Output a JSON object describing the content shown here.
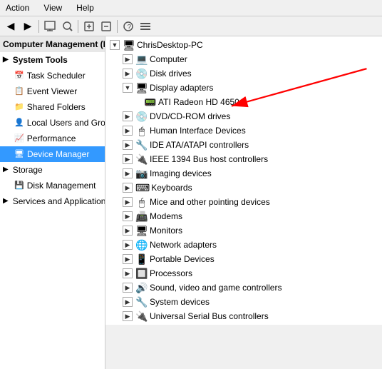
{
  "menu": {
    "items": [
      "Action",
      "View",
      "Help"
    ]
  },
  "toolbar": {
    "buttons": [
      "←",
      "→",
      "⬛",
      "🔧",
      "🔍",
      "⬜",
      "🗑",
      "▶"
    ]
  },
  "left_panel": {
    "header": "Computer Management (Local",
    "sections": [
      {
        "label": "System Tools",
        "bold": true
      },
      {
        "label": "Task Scheduler",
        "indent": 1
      },
      {
        "label": "Event Viewer",
        "indent": 1
      },
      {
        "label": "Shared Folders",
        "indent": 1
      },
      {
        "label": "Local Users and Groups",
        "indent": 1
      },
      {
        "label": "Performance",
        "indent": 1
      },
      {
        "label": "Device Manager",
        "indent": 1,
        "selected": true
      },
      {
        "label": "Storage",
        "bold": false
      },
      {
        "label": "Disk Management",
        "indent": 1
      },
      {
        "label": "Services and Applications",
        "indent": 0
      }
    ]
  },
  "tree": {
    "root": "ChrisDesktop-PC",
    "items": [
      {
        "label": "Computer",
        "indent": 2,
        "expandable": true,
        "icon": "💻"
      },
      {
        "label": "Disk drives",
        "indent": 2,
        "expandable": true,
        "icon": "💿"
      },
      {
        "label": "Display adapters",
        "indent": 2,
        "expandable": false,
        "open": true,
        "icon": "🖥"
      },
      {
        "label": "ATI Radeon HD 4650",
        "indent": 3,
        "expandable": false,
        "icon": "📟"
      },
      {
        "label": "DVD/CD-ROM drives",
        "indent": 2,
        "expandable": true,
        "icon": "💿"
      },
      {
        "label": "Human Interface Devices",
        "indent": 2,
        "expandable": true,
        "icon": "🖱"
      },
      {
        "label": "IDE ATA/ATAPI controllers",
        "indent": 2,
        "expandable": true,
        "icon": "🔧"
      },
      {
        "label": "IEEE 1394 Bus host controllers",
        "indent": 2,
        "expandable": true,
        "icon": "🔌"
      },
      {
        "label": "Imaging devices",
        "indent": 2,
        "expandable": true,
        "icon": "📷"
      },
      {
        "label": "Keyboards",
        "indent": 2,
        "expandable": true,
        "icon": "⌨"
      },
      {
        "label": "Mice and other pointing devices",
        "indent": 2,
        "expandable": true,
        "icon": "🖱"
      },
      {
        "label": "Modems",
        "indent": 2,
        "expandable": true,
        "icon": "📠"
      },
      {
        "label": "Monitors",
        "indent": 2,
        "expandable": true,
        "icon": "🖥"
      },
      {
        "label": "Network adapters",
        "indent": 2,
        "expandable": true,
        "icon": "🌐"
      },
      {
        "label": "Portable Devices",
        "indent": 2,
        "expandable": true,
        "icon": "📱"
      },
      {
        "label": "Processors",
        "indent": 2,
        "expandable": true,
        "icon": "🔲"
      },
      {
        "label": "Sound, video and game controllers",
        "indent": 2,
        "expandable": true,
        "icon": "🔊"
      },
      {
        "label": "System devices",
        "indent": 2,
        "expandable": true,
        "icon": "🔧"
      },
      {
        "label": "Universal Serial Bus controllers",
        "indent": 2,
        "expandable": true,
        "icon": "🔌"
      }
    ]
  },
  "arrow": {
    "visible": true
  }
}
